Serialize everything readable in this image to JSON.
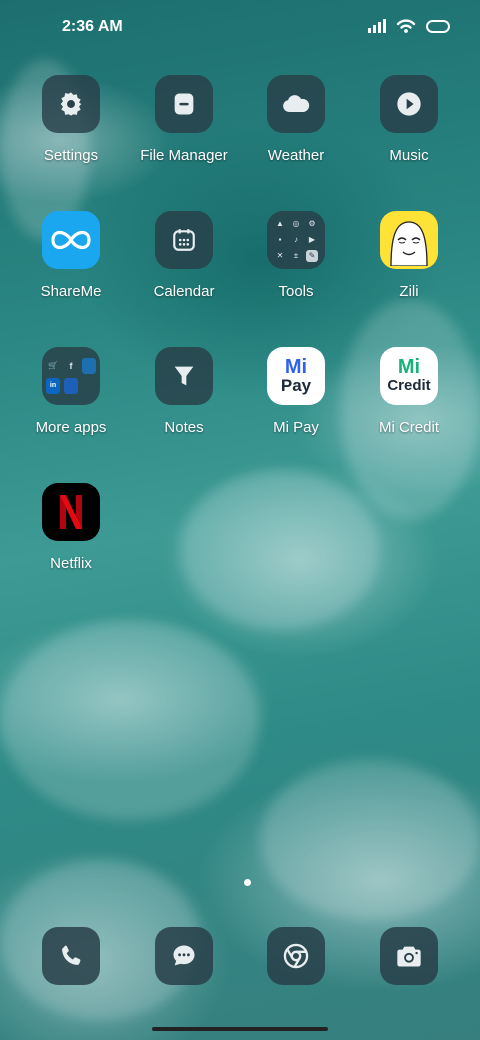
{
  "status_bar": {
    "time": "2:36 AM"
  },
  "apps": [
    {
      "name": "settings",
      "label": "Settings",
      "icon": "gear-icon"
    },
    {
      "name": "file-manager",
      "label": "File Manager",
      "icon": "folder-icon"
    },
    {
      "name": "weather",
      "label": "Weather",
      "icon": "cloud-icon"
    },
    {
      "name": "music",
      "label": "Music",
      "icon": "play-icon"
    },
    {
      "name": "shareme",
      "label": "ShareMe",
      "icon": "infinity-icon"
    },
    {
      "name": "calendar",
      "label": "Calendar",
      "icon": "calendar-icon"
    },
    {
      "name": "tools",
      "label": "Tools",
      "icon": "tools-folder-icon"
    },
    {
      "name": "zili",
      "label": "Zili",
      "icon": "zili-face-icon"
    },
    {
      "name": "more-apps",
      "label": "More apps",
      "icon": "apps-folder-icon"
    },
    {
      "name": "notes",
      "label": "Notes",
      "icon": "notes-icon"
    },
    {
      "name": "mi-pay",
      "label": "Mi Pay",
      "icon": "mi-pay-logo-icon",
      "logo_text": [
        "Mi",
        "Pay"
      ]
    },
    {
      "name": "mi-credit",
      "label": "Mi Credit",
      "icon": "mi-credit-logo-icon",
      "logo_text": [
        "Mi",
        "Credit"
      ]
    },
    {
      "name": "netflix",
      "label": "Netflix",
      "icon": "netflix-logo-icon"
    }
  ],
  "dock": [
    {
      "name": "phone",
      "icon": "phone-icon"
    },
    {
      "name": "messages",
      "icon": "message-icon"
    },
    {
      "name": "chrome",
      "icon": "chrome-icon"
    },
    {
      "name": "camera",
      "icon": "camera-icon"
    }
  ],
  "colors": {
    "shareme_bg": "#1aa7f0",
    "zili_bg": "#ffe236",
    "mipay_blue": "#2e63e8",
    "micredit_green": "#18b27a",
    "netflix_red": "#e50914",
    "icon_bg": "#2b3f48"
  },
  "pager": {
    "pages": 1,
    "current": 1
  }
}
